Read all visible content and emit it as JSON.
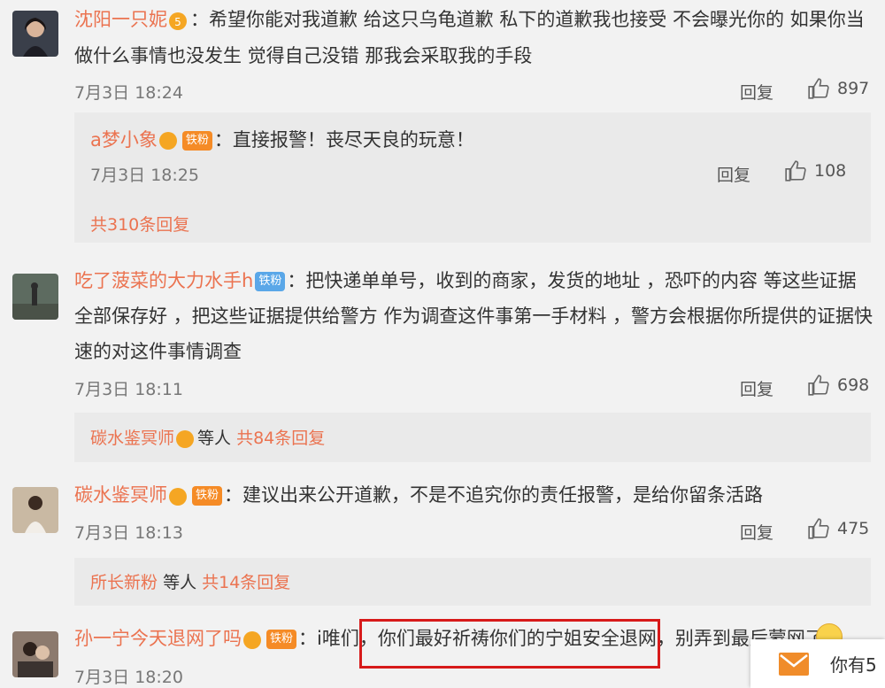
{
  "colors": {
    "username": "#eb7350",
    "badge_orange": "#f58b26",
    "badge_blue": "#5aa7e8",
    "highlight": "#d71a1a"
  },
  "comments": [
    {
      "username": "沈阳一只妮",
      "medal_level": "5",
      "text_lines": [
        "：希望你能对我道歉 给这只乌龟道歉 私下的道歉我也接受 不会曝光你的 如果你当",
        "做什么事情也没发生 觉得自己没错 那我会采取我的手段"
      ],
      "time": "7月3日 18:24",
      "reply": "回复",
      "likes": "897",
      "sub": {
        "username": "a梦小象",
        "badge": "铁粉",
        "text": "：直接报警！丧尽天良的玩意！",
        "time": "7月3日 18:25",
        "reply": "回复",
        "likes": "108",
        "more": "共310条回复"
      }
    },
    {
      "username": "吃了菠菜的大力水手h",
      "badge": "铁粉",
      "text_lines": [
        "：把快递单单号，收到的商家，发货的地址 ，恐吓的内容 等这些证据",
        "全部保存好 ，把这些证据提供给警方 作为调查这件事第一手材料 ，警方会根据你所提供的证据快",
        "速的对这件事情调查"
      ],
      "time": "7月3日 18:11",
      "reply": "回复",
      "likes": "698",
      "sub_summary": {
        "username": "碳水鉴冥师",
        "suffix": "等人",
        "more": "共84条回复"
      }
    },
    {
      "username": "碳水鉴冥师",
      "badge": "铁粉",
      "text_lines": [
        "：建议出来公开道歉，不是不追究你的责任报警，是给你留条活路"
      ],
      "time": "7月3日 18:13",
      "reply": "回复",
      "likes": "475",
      "sub_summary": {
        "username": "所长新粉",
        "suffix": "等人",
        "more": "共14条回复"
      }
    },
    {
      "username": "孙一宁今天退网了吗",
      "badge": "铁粉",
      "text_prefix": "：i唯们",
      "text_highlight": "，你们最好祈祷你们的宁姐安全退网",
      "text_suffix": "，别弄到最后蒙网了",
      "time": "7月3日 18:20"
    }
  ],
  "toast": {
    "text": "你有5"
  }
}
